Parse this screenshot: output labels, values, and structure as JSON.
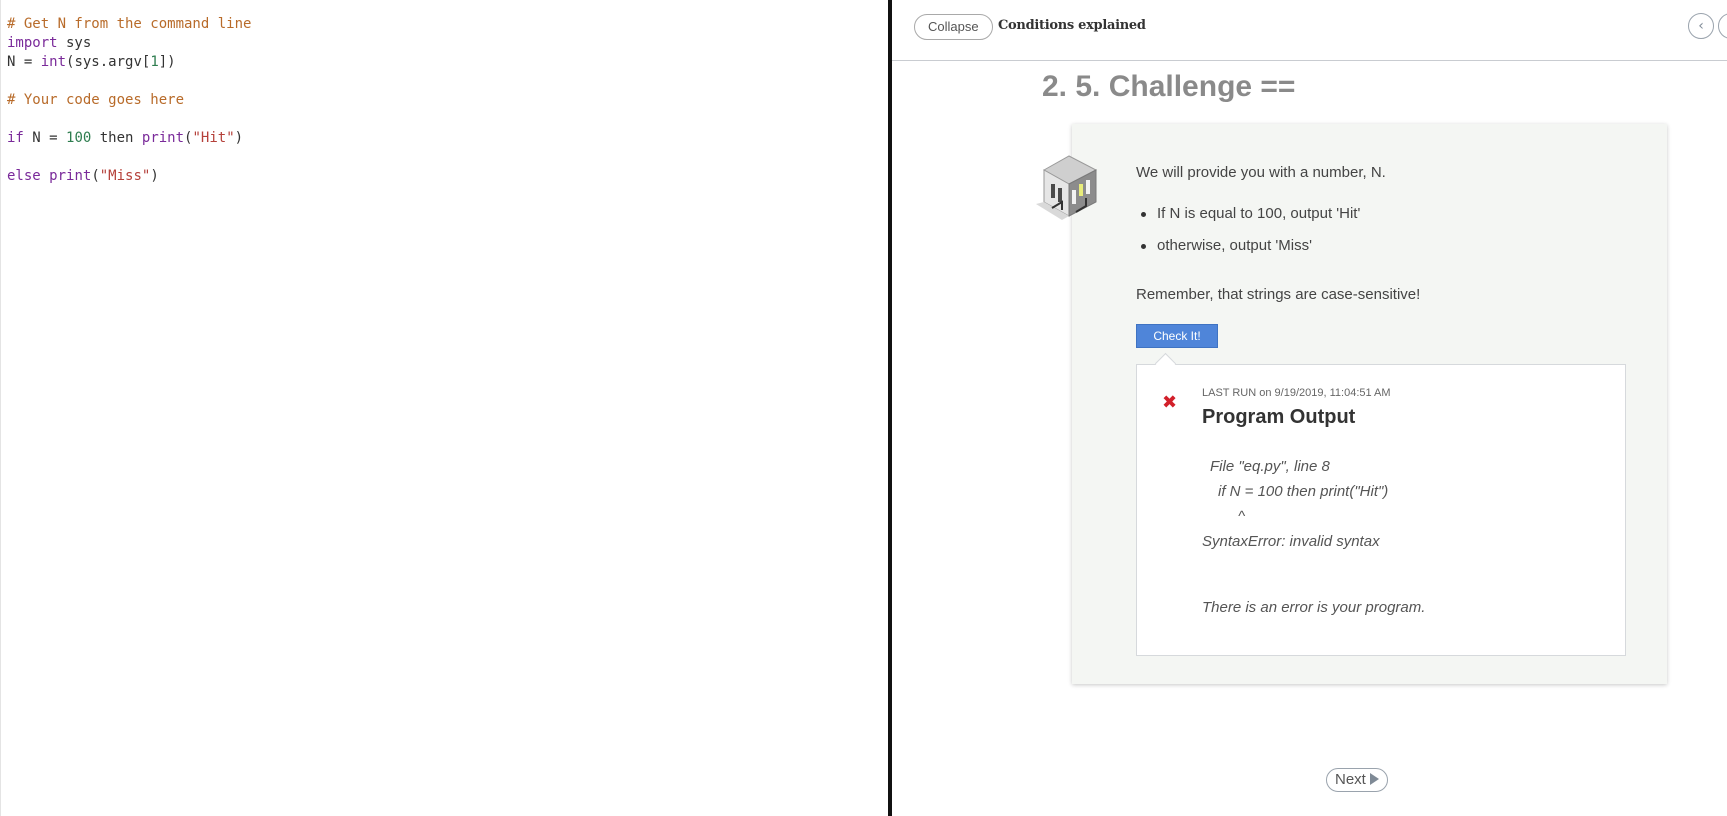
{
  "editor": {
    "lines": [
      [
        {
          "c": "cm",
          "t": "# Get N from the command line"
        }
      ],
      [
        {
          "c": "kw",
          "t": "import"
        },
        {
          "c": "plain",
          "t": " sys"
        }
      ],
      [
        {
          "c": "plain",
          "t": "N = "
        },
        {
          "c": "bi",
          "t": "int"
        },
        {
          "c": "plain",
          "t": "(sys.argv["
        },
        {
          "c": "num",
          "t": "1"
        },
        {
          "c": "plain",
          "t": "])"
        }
      ],
      [],
      [
        {
          "c": "cm",
          "t": "# Your code goes here"
        }
      ],
      [],
      [
        {
          "c": "kw",
          "t": "if"
        },
        {
          "c": "plain",
          "t": " N = "
        },
        {
          "c": "num",
          "t": "100"
        },
        {
          "c": "plain",
          "t": " then "
        },
        {
          "c": "bi",
          "t": "print"
        },
        {
          "c": "plain",
          "t": "("
        },
        {
          "c": "str",
          "t": "\"Hit\""
        },
        {
          "c": "plain",
          "t": ")"
        }
      ],
      [],
      [
        {
          "c": "kw",
          "t": "else"
        },
        {
          "c": "plain",
          "t": " "
        },
        {
          "c": "bi",
          "t": "print"
        },
        {
          "c": "plain",
          "t": "("
        },
        {
          "c": "str",
          "t": "\"Miss\""
        },
        {
          "c": "plain",
          "t": ")"
        }
      ]
    ]
  },
  "header": {
    "collapse_label": "Collapse",
    "section_title": "Conditions explained",
    "prev_icon": "chevron-left-icon"
  },
  "challenge": {
    "heading": "2. 5. Challenge ==",
    "intro": "We will provide you with a number, N.",
    "bullets": [
      "If N is equal to 100, output 'Hit'",
      "otherwise, output 'Miss'"
    ],
    "remember": "Remember, that strings are case-sensitive!",
    "check_label": "Check It!"
  },
  "output": {
    "error_icon": "close-icon",
    "last_run_label": "LAST RUN",
    "last_run_on": "on 9/19/2019, 11:04:51 AM",
    "title": "Program Output",
    "line_1": "File \"eq.py\", line 8",
    "line_2": "if N = 100 then print(\"Hit\")",
    "line_3": "^",
    "line_4": "SyntaxError: invalid syntax",
    "note": "There is an error is your program."
  },
  "footer": {
    "next_label": "Next"
  },
  "colors": {
    "accent_button": "#4f85d9",
    "error_red": "#d21f2a",
    "card_bg": "#f4f6f3"
  }
}
